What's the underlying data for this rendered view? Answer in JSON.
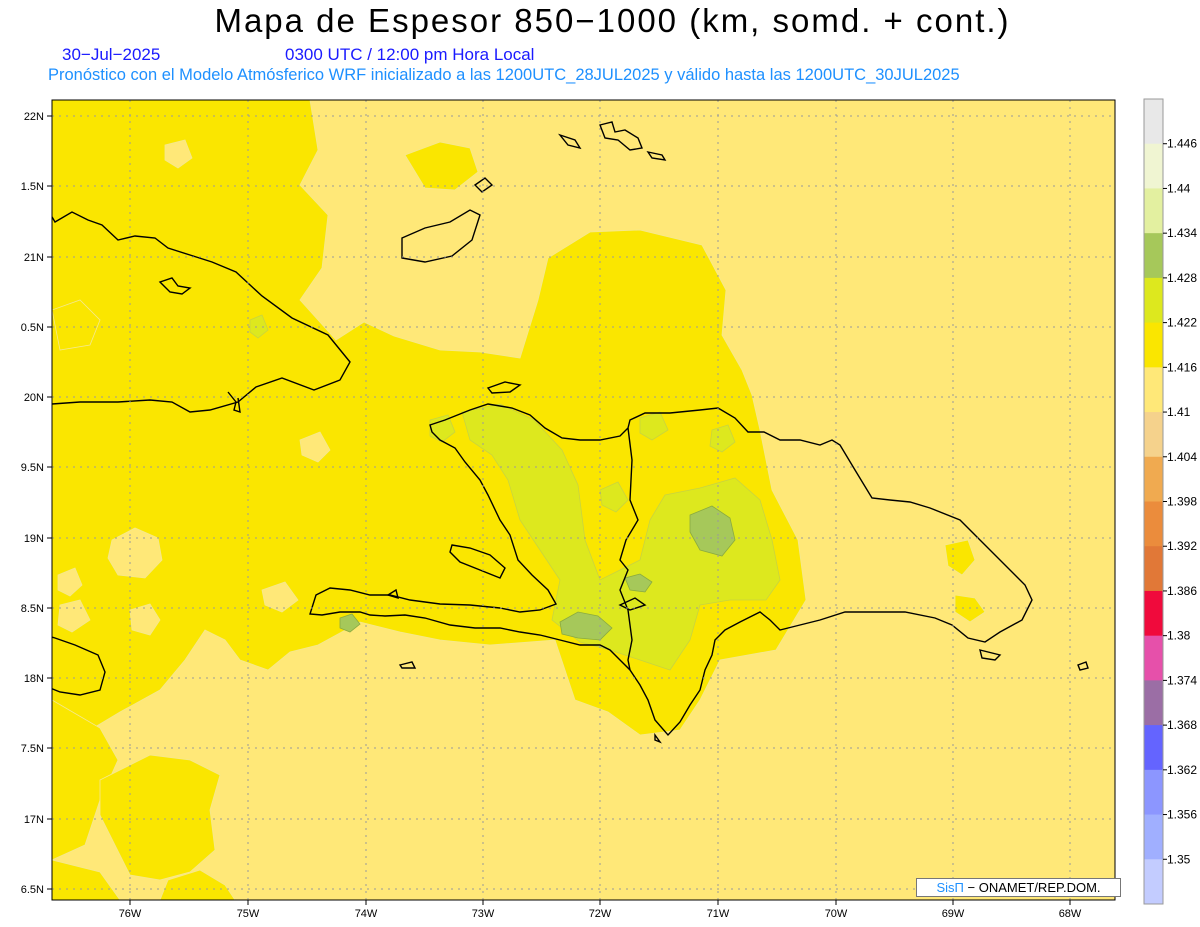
{
  "header": {
    "title": "Mapa de Espesor 850−1000 (km, somd. + cont.)",
    "date": "30−Jul−2025",
    "time": "0300 UTC / 12:00 pm Hora Local",
    "subtitle": "Pronóstico con el Modelo Atmósferico WRF inicializado a las 1200UTC_28JUL2025 y válido hasta las  1200UTC_30JUL2025"
  },
  "axes": {
    "lat_labels": [
      "22N",
      "1.5N",
      "21N",
      "0.5N",
      "20N",
      "9.5N",
      "19N",
      "8.5N",
      "18N",
      "7.5N",
      "17N",
      "6.5N"
    ],
    "lon_labels": [
      "76W",
      "75W",
      "74W",
      "73W",
      "72W",
      "71W",
      "70W",
      "69W",
      "68W"
    ]
  },
  "colorbar": {
    "labels": [
      "1.446",
      "1.44",
      "1.434",
      "1.428",
      "1.422",
      "1.416",
      "1.41",
      "1.404",
      "1.398",
      "1.392",
      "1.386",
      "1.38",
      "1.374",
      "1.368",
      "1.362",
      "1.356",
      "1.35"
    ],
    "colors": [
      "#e8e8e8",
      "#f0f5d2",
      "#e3f0a0",
      "#a6c85a",
      "#dde81e",
      "#fae600",
      "#ffe878",
      "#f5d28c",
      "#f0aa50",
      "#eb8c3c",
      "#e17837",
      "#f00a3c",
      "#e650aa",
      "#9b6ea5",
      "#6464ff",
      "#8c96ff",
      "#a0afff",
      "#c3ccff"
    ]
  },
  "map_colors": {
    "background": "#ffe878",
    "level_1416": "#fae600",
    "level_1422": "#dde81e",
    "level_1428": "#a6c85a",
    "coast": "#000000",
    "grid": "#9a9a9a"
  },
  "credit": {
    "logo": "SisΠ",
    "text": " − ONAMET/REP.DOM."
  }
}
